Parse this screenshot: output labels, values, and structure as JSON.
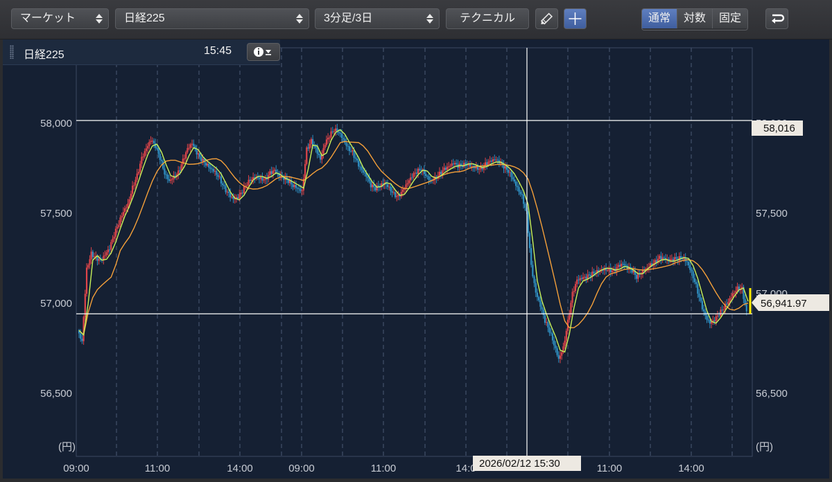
{
  "toolbar": {
    "market_select": "マーケット",
    "symbol_select": "日経225",
    "interval_select": "3分足/3日",
    "technical_button": "テクニカル",
    "scale_modes": [
      "通常",
      "対数",
      "固定"
    ],
    "active_scale_mode": "通常"
  },
  "info_panel": {
    "symbol": "日経225",
    "time": "15:45"
  },
  "chart_data": {
    "type": "candlestick",
    "y_ticks": [
      56500,
      57000,
      57500,
      58000
    ],
    "y_tick_labels": [
      "56,500",
      "57,000",
      "57,500",
      "58,000"
    ],
    "ylim": [
      56150,
      58420
    ],
    "y_unit_label": "(円)",
    "x_tick_labels": [
      "09:00",
      "11:00",
      "14:00",
      "09:00",
      "11:00",
      "14:0",
      "11:00",
      "14:00"
    ],
    "crosshair_time_label": "2026/02/12 15:30",
    "high_marker_label": "58,016",
    "high_marker_value": 58016,
    "last_price_label": "56,941.97",
    "last_price_value": 56941.97,
    "right_partial_tick": "57,000",
    "grid": true,
    "colors": {
      "background": "#152033",
      "up": "#e0454a",
      "down": "#2f8fc2",
      "ma_short": "#c8f25a",
      "ma_long": "#f5a03a",
      "last_price_marker": "#ffee00"
    },
    "price_path": [
      [
        0,
        56850
      ],
      [
        1,
        56800
      ],
      [
        2,
        57200
      ],
      [
        3,
        57280
      ],
      [
        4,
        57250
      ],
      [
        5,
        57230
      ],
      [
        6,
        57260
      ],
      [
        7,
        57300
      ],
      [
        8,
        57380
      ],
      [
        9,
        57450
      ],
      [
        10,
        57520
      ],
      [
        11,
        57560
      ],
      [
        12,
        57650
      ],
      [
        13,
        57710
      ],
      [
        14,
        57800
      ],
      [
        15,
        57850
      ],
      [
        16,
        57900
      ],
      [
        17,
        57870
      ],
      [
        18,
        57810
      ],
      [
        19,
        57730
      ],
      [
        20,
        57690
      ],
      [
        21,
        57710
      ],
      [
        22,
        57730
      ],
      [
        23,
        57790
      ],
      [
        24,
        57850
      ],
      [
        25,
        57880
      ],
      [
        26,
        57830
      ],
      [
        27,
        57800
      ],
      [
        28,
        57780
      ],
      [
        29,
        57760
      ],
      [
        30,
        57740
      ],
      [
        31,
        57700
      ],
      [
        32,
        57640
      ],
      [
        33,
        57600
      ],
      [
        34,
        57570
      ],
      [
        35,
        57580
      ],
      [
        36,
        57620
      ],
      [
        37,
        57670
      ],
      [
        38,
        57700
      ],
      [
        39,
        57710
      ],
      [
        40,
        57700
      ],
      [
        41,
        57690
      ],
      [
        42,
        57720
      ],
      [
        43,
        57730
      ],
      [
        44,
        57700
      ],
      [
        45,
        57690
      ],
      [
        46,
        57680
      ],
      [
        47,
        57660
      ],
      [
        48,
        57650
      ],
      [
        49,
        57630
      ],
      [
        50,
        57860
      ],
      [
        51,
        57900
      ],
      [
        52,
        57850
      ],
      [
        53,
        57790
      ],
      [
        54,
        57880
      ],
      [
        55,
        57930
      ],
      [
        56,
        57970
      ],
      [
        57,
        57960
      ],
      [
        58,
        57920
      ],
      [
        59,
        57870
      ],
      [
        60,
        57840
      ],
      [
        61,
        57780
      ],
      [
        62,
        57730
      ],
      [
        63,
        57700
      ],
      [
        64,
        57650
      ],
      [
        65,
        57640
      ],
      [
        66,
        57660
      ],
      [
        67,
        57680
      ],
      [
        68,
        57650
      ],
      [
        69,
        57610
      ],
      [
        70,
        57590
      ],
      [
        71,
        57620
      ],
      [
        72,
        57660
      ],
      [
        73,
        57700
      ],
      [
        74,
        57730
      ],
      [
        75,
        57750
      ],
      [
        76,
        57720
      ],
      [
        77,
        57690
      ],
      [
        78,
        57700
      ],
      [
        79,
        57720
      ],
      [
        80,
        57740
      ],
      [
        81,
        57750
      ],
      [
        82,
        57770
      ],
      [
        83,
        57760
      ],
      [
        84,
        57770
      ],
      [
        85,
        57780
      ],
      [
        86,
        57770
      ],
      [
        87,
        57760
      ],
      [
        88,
        57750
      ],
      [
        89,
        57770
      ],
      [
        90,
        57780
      ],
      [
        91,
        57790
      ],
      [
        92,
        57780
      ],
      [
        93,
        57760
      ],
      [
        94,
        57740
      ],
      [
        95,
        57700
      ],
      [
        96,
        57650
      ],
      [
        97,
        57600
      ],
      [
        98,
        57500
      ],
      [
        99,
        57200
      ],
      [
        100,
        57050
      ],
      [
        101,
        56980
      ],
      [
        102,
        56900
      ],
      [
        103,
        56850
      ],
      [
        104,
        56780
      ],
      [
        105,
        56700
      ],
      [
        106,
        56760
      ],
      [
        107,
        56900
      ],
      [
        108,
        57050
      ],
      [
        109,
        57120
      ],
      [
        110,
        57130
      ],
      [
        111,
        57140
      ],
      [
        112,
        57160
      ],
      [
        113,
        57180
      ],
      [
        114,
        57190
      ],
      [
        115,
        57200
      ],
      [
        116,
        57190
      ],
      [
        117,
        57180
      ],
      [
        118,
        57200
      ],
      [
        119,
        57210
      ],
      [
        120,
        57190
      ],
      [
        121,
        57180
      ],
      [
        122,
        57150
      ],
      [
        123,
        57180
      ],
      [
        124,
        57200
      ],
      [
        125,
        57220
      ],
      [
        126,
        57230
      ],
      [
        127,
        57250
      ],
      [
        128,
        57240
      ],
      [
        129,
        57230
      ],
      [
        130,
        57240
      ],
      [
        131,
        57250
      ],
      [
        132,
        57260
      ],
      [
        133,
        57240
      ],
      [
        134,
        57180
      ],
      [
        135,
        57100
      ],
      [
        136,
        57000
      ],
      [
        137,
        56920
      ],
      [
        138,
        56880
      ],
      [
        139,
        56900
      ],
      [
        140,
        56940
      ],
      [
        141,
        56980
      ],
      [
        142,
        57020
      ],
      [
        143,
        57060
      ],
      [
        144,
        57090
      ],
      [
        145,
        57080
      ],
      [
        146,
        56942
      ]
    ]
  }
}
